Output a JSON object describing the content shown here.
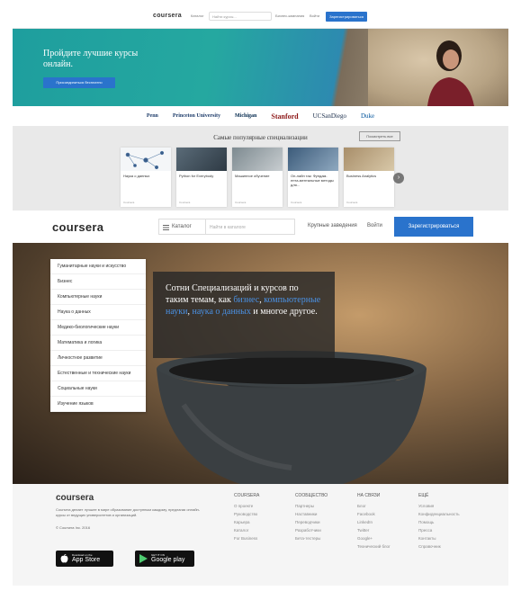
{
  "mini_nav": {
    "logo": "coursera",
    "catalog": "Каталог",
    "search_placeholder": "Найти курсы...",
    "link1": "Бизнес-кампания",
    "link2": "Войти",
    "signup": "Зарегистрироваться"
  },
  "hero": {
    "title": "Пройдите лучшие курсы онлайн.",
    "button": "Присоединиться бесплатно"
  },
  "partners": [
    "Penn",
    "Princeton University",
    "Michigan",
    "Stanford",
    "UCSanDiego",
    "Duke"
  ],
  "specializations": {
    "title": "Самые популярные специализации",
    "view_all": "Посмотреть все",
    "cards": [
      {
        "title": "Наука о данных",
        "foot": "Coursera"
      },
      {
        "title": "Python for Everybody",
        "foot": "Coursera"
      },
      {
        "title": "Машинное обучение",
        "foot": "Coursera"
      },
      {
        "title": "Он-лайн так: Фундам-ента-ментальные методы для...",
        "foot": "Coursera"
      },
      {
        "title": "Business Analytics",
        "foot": "Coursera"
      }
    ]
  },
  "main_nav": {
    "logo": "coursera",
    "catalog": "Каталог",
    "search_placeholder": "Найти в каталоге",
    "institutions": "Крупные заведения",
    "login": "Войти",
    "signup": "Зарегистрироваться"
  },
  "categories": [
    "Гуманитарные науки и искусство",
    "Бизнес",
    "Компьютерные науки",
    "Наука о данных",
    "Медико-биологические науки",
    "Математика и логика",
    "Личностное развитие",
    "Естественные и технические науки",
    "Социальные науки",
    "Изучение языков"
  ],
  "overlay": {
    "line1": "Сотни Специализаций и курсов по таким темам, как ",
    "link1": "бизнес",
    "sep1": ", ",
    "link2": "компьютерные науки",
    "sep2": ", ",
    "link3": "наука о данных",
    "line2": " и многое другое."
  },
  "footer": {
    "logo": "coursera",
    "text": "Coursera делает лучшее в мире образование доступным каждому, предлагая онлайн-курсы от ведущих университетов и организаций.",
    "copyright": "© Coursera Inc. 2016",
    "appstore_small": "Download on the",
    "appstore_big": "App Store",
    "gplay_small": "GET IT ON",
    "gplay_big": "Google play",
    "columns": [
      {
        "head": "COURSERA",
        "links": [
          "О проекте",
          "Руководство",
          "Карьера",
          "Каталог",
          "For Business"
        ]
      },
      {
        "head": "СООБЩЕСТВО",
        "links": [
          "Партнеры",
          "Наставники",
          "Переводчики",
          "Разработчики",
          "Бета-тестеры"
        ]
      },
      {
        "head": "НА СВЯЗИ",
        "links": [
          "Блог",
          "Facebook",
          "LinkedIn",
          "Twitter",
          "Google+",
          "Технический блог"
        ]
      },
      {
        "head": "ЕЩЁ",
        "links": [
          "Условия",
          "Конфиденциальность",
          "Помощь",
          "Пресса",
          "Контакты",
          "Справочник"
        ]
      }
    ]
  },
  "colors": {
    "brand_blue": "#2a73cc",
    "hero_teal": "#1e9e9e",
    "link_blue": "#4a90e2"
  }
}
